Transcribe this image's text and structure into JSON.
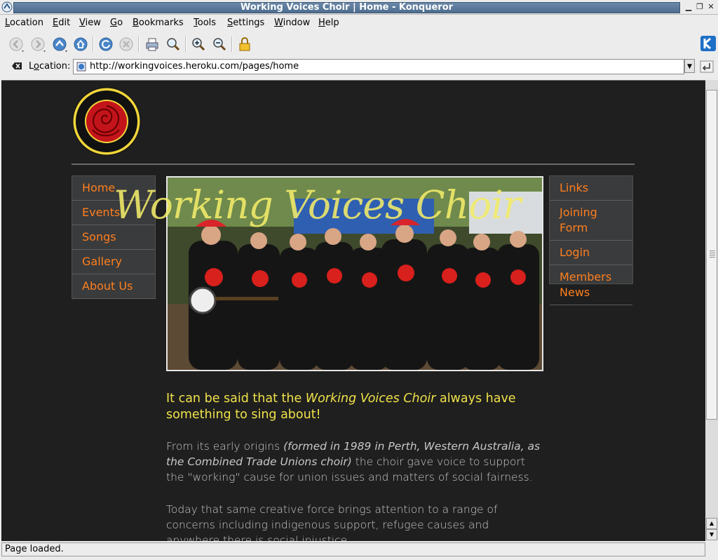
{
  "window": {
    "title": "Working Voices Choir | Home - Konqueror"
  },
  "menubar": [
    {
      "label": "Location",
      "accel": "L",
      "rest": "ocation"
    },
    {
      "label": "Edit",
      "accel": "E",
      "rest": "dit"
    },
    {
      "label": "View",
      "accel": "V",
      "rest": "iew"
    },
    {
      "label": "Go",
      "accel": "G",
      "rest": "o"
    },
    {
      "label": "Bookmarks",
      "accel": "B",
      "rest": "ookmarks"
    },
    {
      "label": "Tools",
      "accel": "T",
      "rest": "ools"
    },
    {
      "label": "Settings",
      "accel": "S",
      "rest": "ettings"
    },
    {
      "label": "Window",
      "accel": "W",
      "rest": "indow"
    },
    {
      "label": "Help",
      "accel": "H",
      "rest": "elp"
    }
  ],
  "toolbar": {
    "icons": [
      "back-icon",
      "forward-icon",
      "up-icon",
      "home-icon",
      "reload-icon",
      "stop-icon",
      "print-icon",
      "find-icon",
      "zoom-in-icon",
      "zoom-out-icon",
      "security-lock-icon"
    ]
  },
  "location": {
    "label": "Location:",
    "label_accel": "o",
    "url": "http://workingvoices.heroku.com/pages/home"
  },
  "page": {
    "left_nav": [
      "Home",
      "Events",
      "Songs",
      "Gallery",
      "About Us"
    ],
    "right_nav": [
      "Links",
      "Joining Form",
      "Login",
      "Members News"
    ],
    "hero_title": "Working Voices Choir",
    "lead_part1": "It can be said that the ",
    "lead_em": "Working Voices Choir",
    "lead_part2": " always have something to sing about!",
    "para1_part1": "From its early origins ",
    "para1_em": "(formed in 1989 in Perth, Western Australia, as the Combined Trade Unions choir)",
    "para1_part2": " the choir gave voice to support the \"working\" cause for union issues and matters of social fairness.",
    "para2": "Today that same creative force brings attention to a range of concerns including indigenous support, refugee causes and anywhere there is social injustice."
  },
  "status": {
    "text": "Page loaded."
  },
  "colors": {
    "nav_link": "#ff7f1e",
    "lead_text": "#f0e24a",
    "page_bg": "#1f1f1f",
    "title_bar": "#4e6d8f"
  }
}
